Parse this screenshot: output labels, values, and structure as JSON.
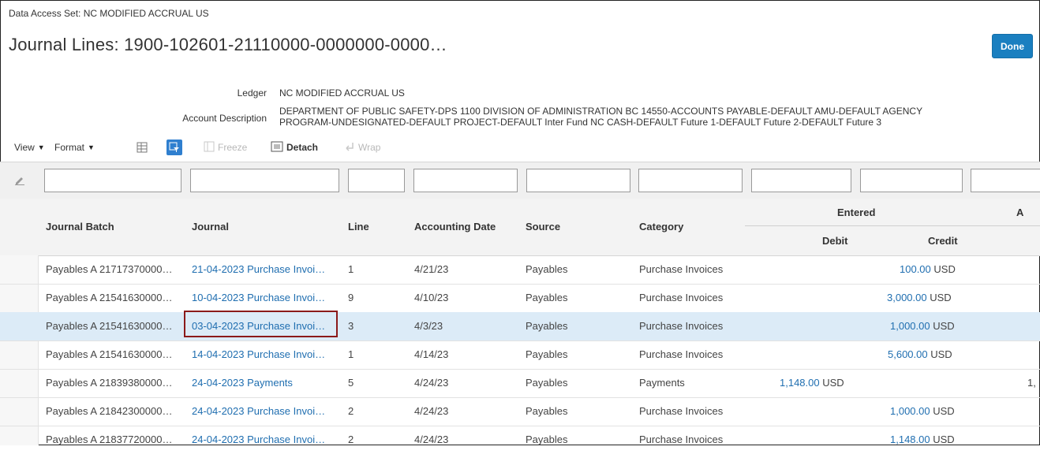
{
  "header": {
    "data_access_set": "Data Access Set: NC MODIFIED ACCRUAL US",
    "title": "Journal Lines: 1900-102601-21110000-0000000-0000…",
    "done_label": "Done"
  },
  "info": {
    "ledger_label": "Ledger",
    "ledger_value": "NC MODIFIED ACCRUAL US",
    "account_desc_label": "Account Description",
    "account_desc_line1": "DEPARTMENT OF PUBLIC SAFETY-DPS 1100 DIVISION OF ADMINISTRATION BC 14550-ACCOUNTS PAYABLE-DEFAULT AMU-DEFAULT AGENCY",
    "account_desc_line2": "PROGRAM-UNDESIGNATED-DEFAULT PROJECT-DEFAULT Inter Fund NC CASH-DEFAULT Future 1-DEFAULT Future 2-DEFAULT Future 3"
  },
  "toolbar": {
    "view_label": "View",
    "format_label": "Format",
    "freeze_label": "Freeze",
    "detach_label": "Detach",
    "wrap_label": "Wrap"
  },
  "table": {
    "headers": {
      "journal_batch": "Journal Batch",
      "journal": "Journal",
      "line": "Line",
      "accounting_date": "Accounting Date",
      "source": "Source",
      "category": "Category",
      "entered": "Entered",
      "debit": "Debit",
      "credit": "Credit",
      "next_col_partial": "A"
    },
    "rows": [
      {
        "batch": "Payables A 21717370000…",
        "journal": "21-04-2023 Purchase Invoi…",
        "line": "1",
        "date": "4/21/23",
        "source": "Payables",
        "category": "Purchase Invoices",
        "debit": "",
        "debit_cur": "",
        "credit": "100.00",
        "credit_cur": "USD",
        "extra": ""
      },
      {
        "batch": "Payables A 21541630000…",
        "journal": "10-04-2023 Purchase Invoi…",
        "line": "9",
        "date": "4/10/23",
        "source": "Payables",
        "category": "Purchase Invoices",
        "debit": "",
        "debit_cur": "",
        "credit": "3,000.00",
        "credit_cur": "USD",
        "extra": ""
      },
      {
        "batch": "Payables A 21541630000…",
        "journal": "03-04-2023 Purchase Invoi…",
        "line": "3",
        "date": "4/3/23",
        "source": "Payables",
        "category": "Purchase Invoices",
        "debit": "",
        "debit_cur": "",
        "credit": "1,000.00",
        "credit_cur": "USD",
        "extra": ""
      },
      {
        "batch": "Payables A 21541630000…",
        "journal": "14-04-2023 Purchase Invoi…",
        "line": "1",
        "date": "4/14/23",
        "source": "Payables",
        "category": "Purchase Invoices",
        "debit": "",
        "debit_cur": "",
        "credit": "5,600.00",
        "credit_cur": "USD",
        "extra": ""
      },
      {
        "batch": "Payables A 21839380000…",
        "journal": "24-04-2023 Payments",
        "line": "5",
        "date": "4/24/23",
        "source": "Payables",
        "category": "Payments",
        "debit": "1,148.00",
        "debit_cur": "USD",
        "credit": "",
        "credit_cur": "",
        "extra": "1,"
      },
      {
        "batch": "Payables A 21842300000…",
        "journal": "24-04-2023 Purchase Invoi…",
        "line": "2",
        "date": "4/24/23",
        "source": "Payables",
        "category": "Purchase Invoices",
        "debit": "",
        "debit_cur": "",
        "credit": "1,000.00",
        "credit_cur": "USD",
        "extra": ""
      },
      {
        "batch": "Payables A 21837720000…",
        "journal": "24-04-2023 Purchase Invoi…",
        "line": "2",
        "date": "4/24/23",
        "source": "Payables",
        "category": "Purchase Invoices",
        "debit": "",
        "debit_cur": "",
        "credit": "1,148.00",
        "credit_cur": "USD",
        "extra": ""
      }
    ],
    "selected_row": 2
  },
  "colors": {
    "link": "#1f6eb0",
    "done_button": "#1a7fc0",
    "selected_row": "#dcebf7",
    "highlight_box": "#8b1a1a"
  }
}
